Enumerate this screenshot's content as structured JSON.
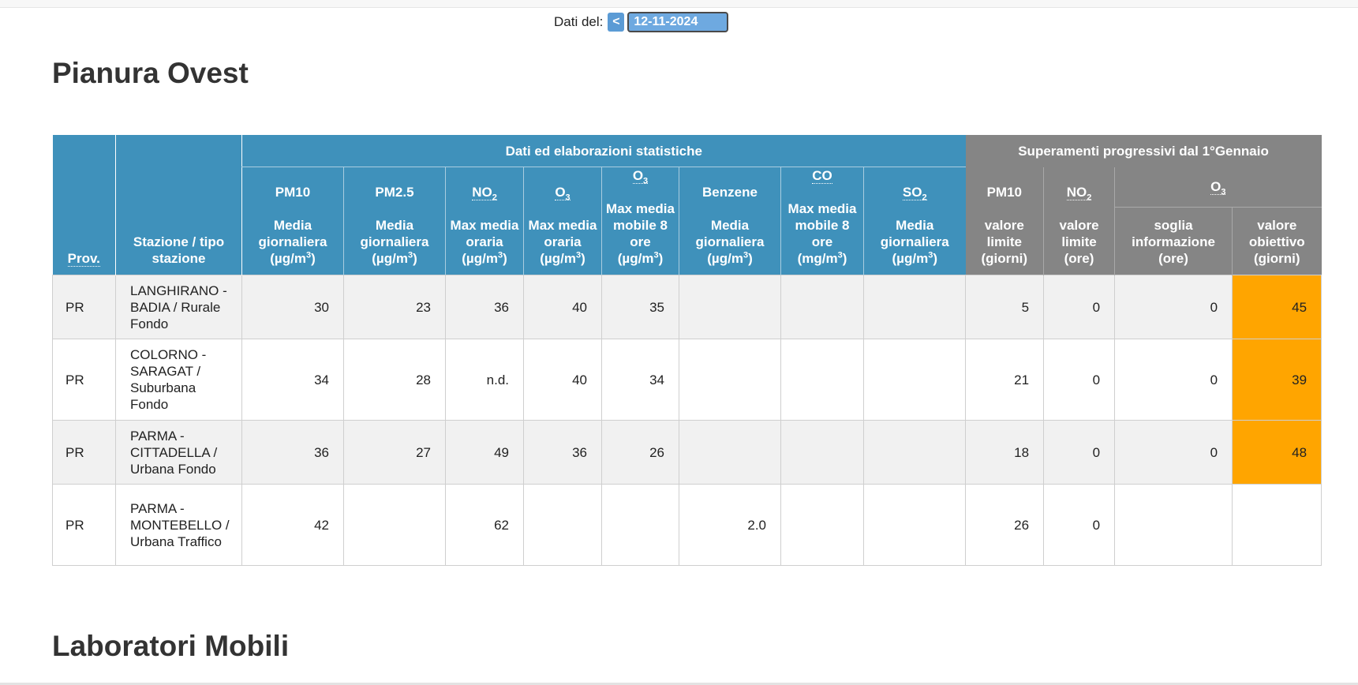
{
  "date_bar": {
    "label": "Dati del:",
    "prev_label": "<",
    "date_value": "12-11-2024"
  },
  "section_title": "Pianura Ovest",
  "next_section_title": "Laboratori Mobili",
  "table": {
    "group_stats": "Dati ed elaborazioni statistiche",
    "group_exceed": "Superamenti progressivi dal 1°Gennaio",
    "col_prov": "Prov.",
    "col_station": "Stazione / tipo stazione",
    "pm10": {
      "name": "PM10",
      "stat": "Media giornaliera",
      "unit_pre": "(µg/m",
      "unit_post": ")"
    },
    "pm25": {
      "name": "PM2.5",
      "stat": "Media giornaliera",
      "unit_pre": "(µg/m",
      "unit_post": ")"
    },
    "no2": {
      "name_main": "NO",
      "name_sub": "2",
      "stat": "Max media oraria",
      "unit_pre": "(µg/m",
      "unit_post": ")"
    },
    "o3": {
      "name_main": "O",
      "name_sub": "3",
      "stat": "Max media oraria",
      "unit_pre": "(µg/m",
      "unit_post": ")"
    },
    "o3_8h": {
      "name_main": "O",
      "name_sub": "3",
      "stat": "Max media mobile 8 ore",
      "unit_pre": "(µg/m",
      "unit_post": ")"
    },
    "benzene": {
      "name": "Benzene",
      "stat": "Media giornaliera",
      "unit_pre": "(µg/m",
      "unit_post": ")"
    },
    "co": {
      "name": "CO",
      "stat": "Max media mobile 8 ore",
      "unit_pre": "(mg/m",
      "unit_post": ")"
    },
    "so2": {
      "name_main": "SO",
      "name_sub": "2",
      "stat": "Media giornaliera",
      "unit_pre": "(µg/m",
      "unit_post": ")"
    },
    "unit_sup": "3",
    "ex_pm10": {
      "name": "PM10",
      "desc": "valore limite (giorni)"
    },
    "ex_no2": {
      "name_main": "NO",
      "name_sub": "2",
      "desc": "valore limite (ore)"
    },
    "ex_o3": {
      "name_main": "O",
      "name_sub": "3"
    },
    "ex_o3_info": "soglia informazione (ore)",
    "ex_o3_target": "valore obiettivo (giorni)",
    "highlight_color": "#ffa500",
    "rows": [
      {
        "prov": "PR",
        "station": "LANGHIRANO - BADIA / Rurale Fondo",
        "pm10": "30",
        "pm25": "23",
        "no2": "36",
        "o3": "40",
        "o3_8h": "35",
        "benzene": "",
        "co": "",
        "so2": "",
        "ex_pm10": "5",
        "ex_no2": "0",
        "ex_o3_info": "0",
        "ex_o3_target": "45"
      },
      {
        "prov": "PR",
        "station": "COLORNO - SARAGAT / Suburbana Fondo",
        "pm10": "34",
        "pm25": "28",
        "no2": "n.d.",
        "o3": "40",
        "o3_8h": "34",
        "benzene": "",
        "co": "",
        "so2": "",
        "ex_pm10": "21",
        "ex_no2": "0",
        "ex_o3_info": "0",
        "ex_o3_target": "39"
      },
      {
        "prov": "PR",
        "station": "PARMA - CITTADELLA / Urbana Fondo",
        "pm10": "36",
        "pm25": "27",
        "no2": "49",
        "o3": "36",
        "o3_8h": "26",
        "benzene": "",
        "co": "",
        "so2": "",
        "ex_pm10": "18",
        "ex_no2": "0",
        "ex_o3_info": "0",
        "ex_o3_target": "48"
      },
      {
        "prov": "PR",
        "station": "PARMA - MONTEBELLO / Urbana Traffico",
        "pm10": "42",
        "pm25": "",
        "no2": "62",
        "o3": "",
        "o3_8h": "",
        "benzene": "2.0",
        "co": "",
        "so2": "",
        "ex_pm10": "26",
        "ex_no2": "0",
        "ex_o3_info": "",
        "ex_o3_target": ""
      }
    ]
  }
}
